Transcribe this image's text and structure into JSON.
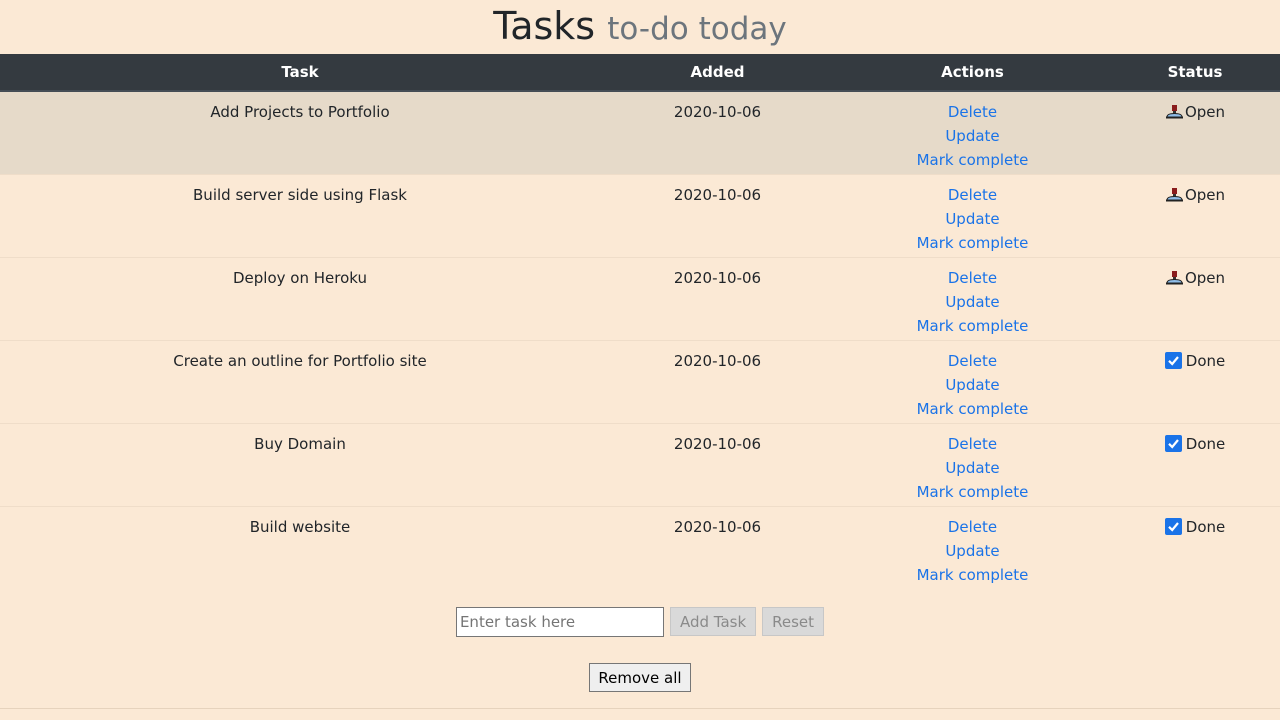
{
  "header": {
    "title": "Tasks",
    "subtitle": "to-do today"
  },
  "table": {
    "columns": {
      "task": "Task",
      "added": "Added",
      "actions": "Actions",
      "status": "Status"
    },
    "action_labels": {
      "delete": "Delete",
      "update": "Update",
      "mark_complete": "Mark complete"
    },
    "rows": [
      {
        "task": "Add Projects to Portfolio",
        "added": "2020-10-06",
        "status": "Open",
        "status_icon": "hammer-icon"
      },
      {
        "task": "Build server side using Flask",
        "added": "2020-10-06",
        "status": "Open",
        "status_icon": "hammer-icon"
      },
      {
        "task": "Deploy on Heroku",
        "added": "2020-10-06",
        "status": "Open",
        "status_icon": "hammer-icon"
      },
      {
        "task": "Create an outline for Portfolio site",
        "added": "2020-10-06",
        "status": "Done",
        "status_icon": "checkbox-checked-icon"
      },
      {
        "task": "Buy Domain",
        "added": "2020-10-06",
        "status": "Done",
        "status_icon": "checkbox-checked-icon"
      },
      {
        "task": "Build website",
        "added": "2020-10-06",
        "status": "Done",
        "status_icon": "checkbox-checked-icon"
      }
    ]
  },
  "form": {
    "input_placeholder": "Enter task here",
    "input_value": "",
    "add_label": "Add Task",
    "reset_label": "Reset",
    "remove_all_label": "Remove all"
  },
  "colors": {
    "background": "#fbe9d5",
    "header_bg": "#343a40",
    "link": "#1a73e8",
    "striped_row": "#e6dac9"
  }
}
